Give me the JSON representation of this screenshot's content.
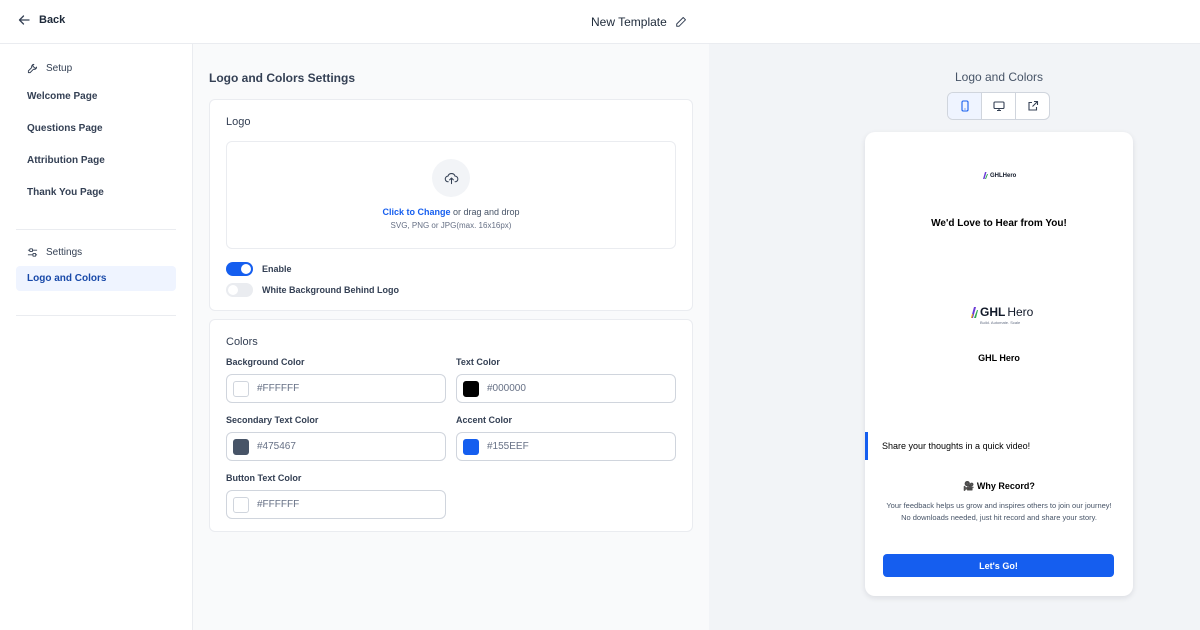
{
  "header": {
    "back_label": "Back",
    "title": "New Template"
  },
  "sidebar": {
    "setup_label": "Setup",
    "setup_items": [
      {
        "label": "Welcome Page"
      },
      {
        "label": "Questions Page"
      },
      {
        "label": "Attribution Page"
      },
      {
        "label": "Thank You Page"
      }
    ],
    "settings_label": "Settings",
    "settings_items": [
      {
        "label": "Logo and Colors",
        "active": true
      }
    ]
  },
  "main": {
    "title": "Logo and Colors Settings",
    "logo_card": {
      "label": "Logo",
      "upload_link": "Click to Change",
      "upload_text": "or drag and drop",
      "upload_hint": "SVG, PNG or JPG(max. 16x16px)",
      "enable_label": "Enable",
      "enable_on": true,
      "white_bg_label": "White Background Behind Logo",
      "white_bg_on": false
    },
    "colors_card": {
      "label": "Colors",
      "fields": [
        {
          "label": "Background Color",
          "value": "#FFFFFF",
          "swatch": "#FFFFFF"
        },
        {
          "label": "Text Color",
          "value": "#000000",
          "swatch": "#000000"
        },
        {
          "label": "Secondary Text Color",
          "value": "#475467",
          "swatch": "#475467"
        },
        {
          "label": "Accent Color",
          "value": "#155EEF",
          "swatch": "#155EEF"
        },
        {
          "label": "Button Text Color",
          "value": "#FFFFFF",
          "swatch": "#FFFFFF"
        }
      ]
    }
  },
  "preview": {
    "title": "Logo and Colors",
    "devices": [
      "mobile-icon",
      "desktop-icon",
      "external-link-icon"
    ],
    "active_device": "mobile",
    "small_logo_text": "GHLHero",
    "heading": "We'd Love to Hear from You!",
    "logo_text_bold": "GHL",
    "logo_text_regular": "Hero",
    "logo_tagline": "Build. Automate. Scale",
    "brand_name": "GHL Hero",
    "share_text": "Share your thoughts in a quick video!",
    "why_title": "Why Record?",
    "why_description": "Your feedback helps us grow and inspires others to join our journey! No downloads needed, just hit record and share your story.",
    "button_label": "Let's Go!"
  },
  "colors": {
    "accent": "#155EEF",
    "active_nav_bg": "#EFF4FF"
  }
}
